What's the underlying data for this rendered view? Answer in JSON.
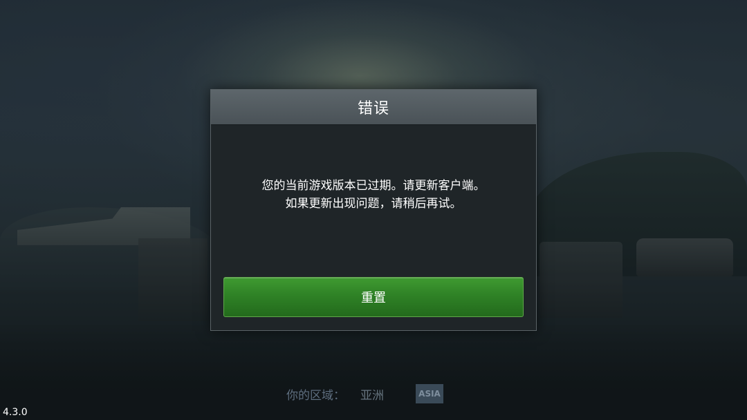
{
  "dialog": {
    "title": "错误",
    "message_line1": "您的当前游戏版本已过期。请更新客户端。",
    "message_line2": "如果更新出现问题，请稍后再试。",
    "button_label": "重置"
  },
  "region": {
    "label": "你的区域：",
    "value": "亚洲",
    "badge": "ASIA"
  },
  "version": "4.3.0",
  "colors": {
    "button_green": "#2f8226",
    "dialog_bg": "#1f2528",
    "header_bg": "#5d666b"
  }
}
